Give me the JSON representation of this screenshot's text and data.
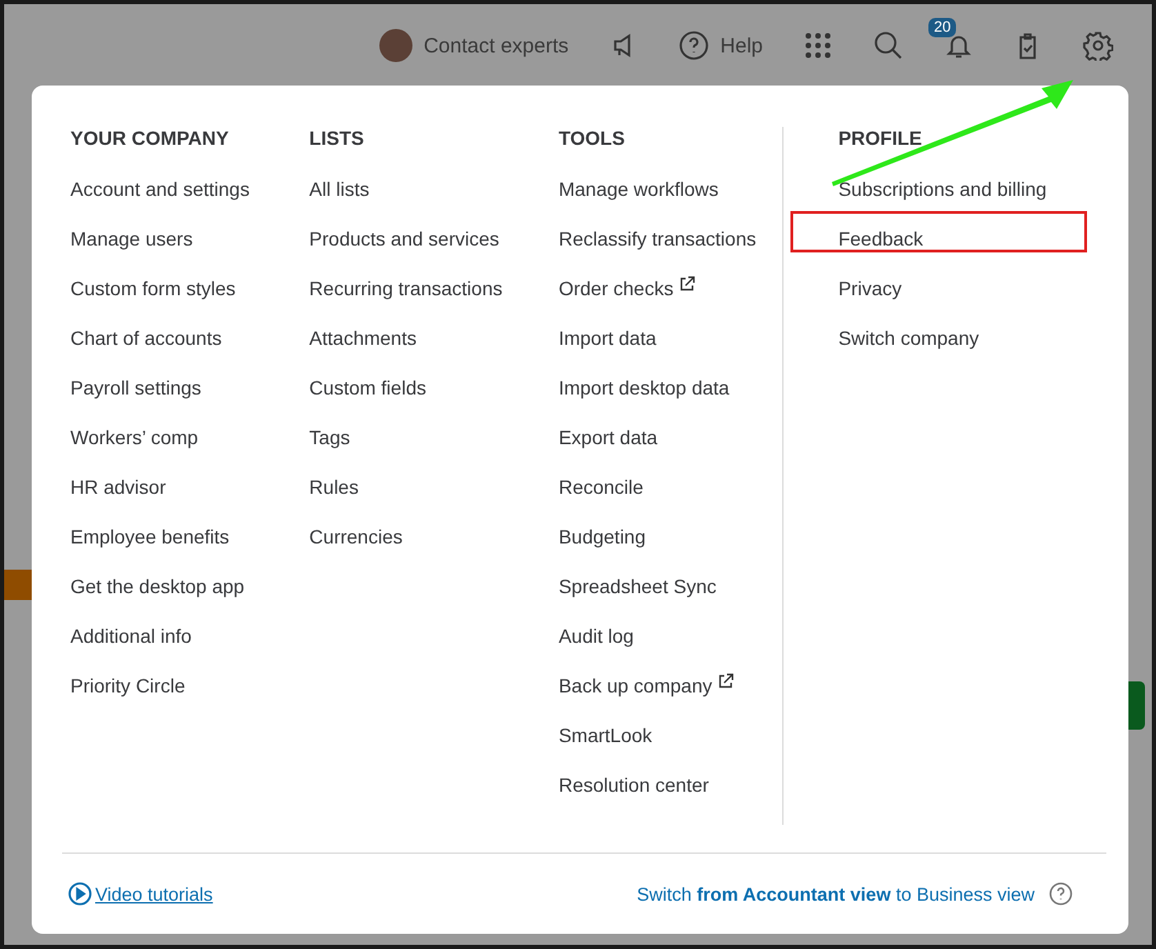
{
  "top_bar": {
    "contact_label": "Contact experts",
    "help_label": "Help",
    "notification_count": "20"
  },
  "menu": {
    "columns": [
      {
        "heading": "YOUR COMPANY",
        "items": [
          {
            "label": "Account and settings",
            "external": false,
            "highlighted": false
          },
          {
            "label": "Manage users",
            "external": false,
            "highlighted": false
          },
          {
            "label": "Custom form styles",
            "external": false,
            "highlighted": false
          },
          {
            "label": "Chart of accounts",
            "external": false,
            "highlighted": false
          },
          {
            "label": "Payroll settings",
            "external": false,
            "highlighted": false
          },
          {
            "label": "Workers’ comp",
            "external": false,
            "highlighted": false
          },
          {
            "label": "HR advisor",
            "external": false,
            "highlighted": false
          },
          {
            "label": "Employee benefits",
            "external": false,
            "highlighted": false
          },
          {
            "label": "Get the desktop app",
            "external": false,
            "highlighted": false
          },
          {
            "label": "Additional info",
            "external": false,
            "highlighted": false
          },
          {
            "label": "Priority Circle",
            "external": false,
            "highlighted": false
          }
        ]
      },
      {
        "heading": "LISTS",
        "items": [
          {
            "label": "All lists",
            "external": false,
            "highlighted": false
          },
          {
            "label": "Products and services",
            "external": false,
            "highlighted": false
          },
          {
            "label": "Recurring transactions",
            "external": false,
            "highlighted": false
          },
          {
            "label": "Attachments",
            "external": false,
            "highlighted": false
          },
          {
            "label": "Custom fields",
            "external": false,
            "highlighted": false
          },
          {
            "label": "Tags",
            "external": false,
            "highlighted": false
          },
          {
            "label": "Rules",
            "external": false,
            "highlighted": false
          },
          {
            "label": "Currencies",
            "external": false,
            "highlighted": false
          }
        ]
      },
      {
        "heading": "TOOLS",
        "items": [
          {
            "label": "Manage workflows",
            "external": false,
            "highlighted": false
          },
          {
            "label": "Reclassify transactions",
            "external": false,
            "highlighted": false
          },
          {
            "label": "Order checks",
            "external": true,
            "highlighted": false
          },
          {
            "label": "Import data",
            "external": false,
            "highlighted": false
          },
          {
            "label": "Import desktop data",
            "external": false,
            "highlighted": false
          },
          {
            "label": "Export data",
            "external": false,
            "highlighted": false
          },
          {
            "label": "Reconcile",
            "external": false,
            "highlighted": false
          },
          {
            "label": "Budgeting",
            "external": false,
            "highlighted": false
          },
          {
            "label": "Spreadsheet Sync",
            "external": false,
            "highlighted": false
          },
          {
            "label": "Audit log",
            "external": false,
            "highlighted": false
          },
          {
            "label": "Back up company",
            "external": true,
            "highlighted": false
          },
          {
            "label": "SmartLook",
            "external": false,
            "highlighted": false
          },
          {
            "label": "Resolution center",
            "external": false,
            "highlighted": false
          }
        ]
      },
      {
        "heading": "PROFILE",
        "items": [
          {
            "label": "Subscriptions and billing",
            "external": false,
            "highlighted": false
          },
          {
            "label": "Feedback",
            "external": false,
            "highlighted": true
          },
          {
            "label": "Privacy",
            "external": false,
            "highlighted": false
          },
          {
            "label": "Switch company",
            "external": false,
            "highlighted": false
          }
        ]
      }
    ]
  },
  "footer": {
    "video_link": "Video tutorials",
    "switch_text": "Switch **from Accountant view** to Business view"
  }
}
